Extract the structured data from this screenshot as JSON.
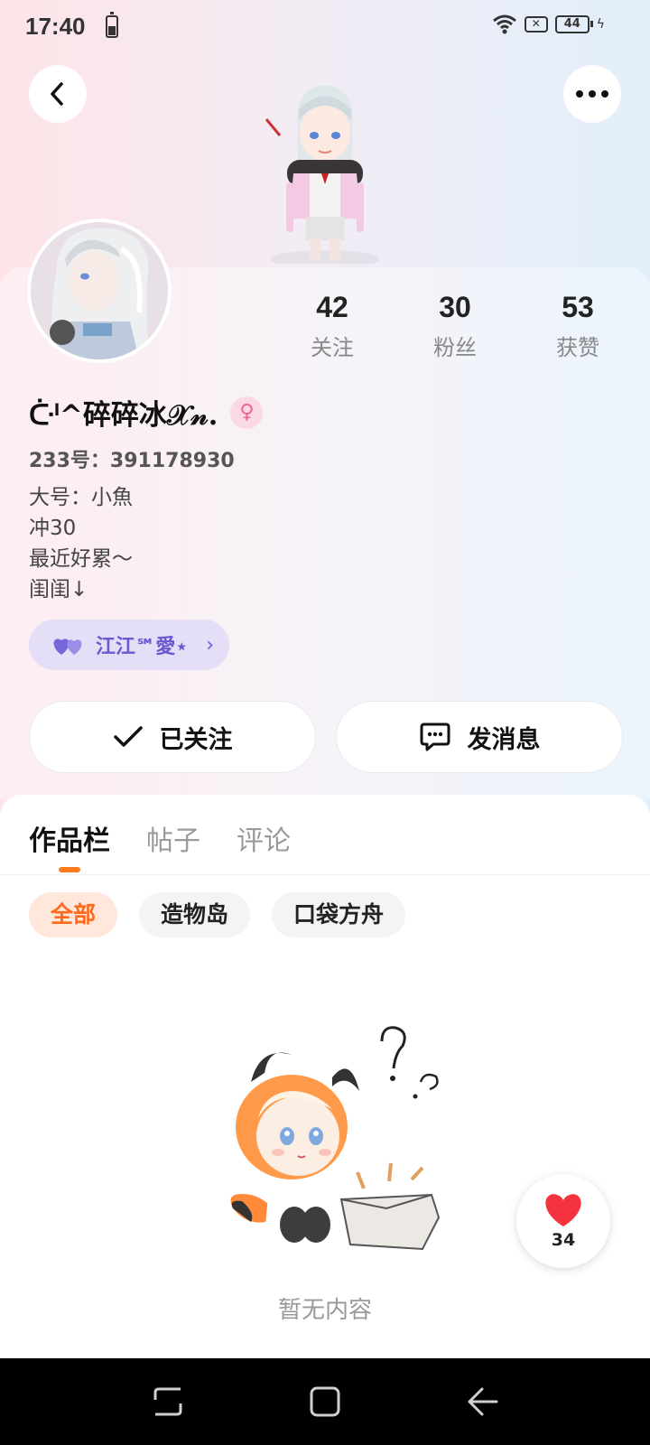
{
  "status_bar": {
    "time": "17:40",
    "battery_level": "44",
    "icons": [
      "battery-icon",
      "wifi-icon",
      "no-sim-icon",
      "charging-icon"
    ]
  },
  "header": {
    "back_icon": "chevron-left-icon",
    "more_icon": "more-dots-icon"
  },
  "profile": {
    "stats": [
      {
        "value": "42",
        "label": "关注"
      },
      {
        "value": "30",
        "label": "粉丝"
      },
      {
        "value": "53",
        "label": "获赞"
      }
    ],
    "nickname": "ᑤᑊ^碎碎冰𝒳𝓃.",
    "gender": "female",
    "uid": "233号：391178930",
    "bio": [
      "大号：小魚",
      "冲30",
      "最近好累～",
      "闺闺↓"
    ],
    "cp": {
      "name": "江江℠愛⋆"
    }
  },
  "actions": {
    "follow_label": "已关注",
    "message_label": "发消息"
  },
  "tabs": [
    {
      "label": "作品栏",
      "active": true
    },
    {
      "label": "帖子",
      "active": false
    },
    {
      "label": "评论",
      "active": false
    }
  ],
  "chips": [
    {
      "label": "全部",
      "active": true
    },
    {
      "label": "造物岛",
      "active": false
    },
    {
      "label": "口袋方舟",
      "active": false
    }
  ],
  "empty_state": {
    "text": "暂无内容"
  },
  "like_fab": {
    "count": "34"
  },
  "colors": {
    "accent": "#ff7a1a",
    "cp_purple": "#6a5ad0",
    "like_red": "#f5333f"
  }
}
